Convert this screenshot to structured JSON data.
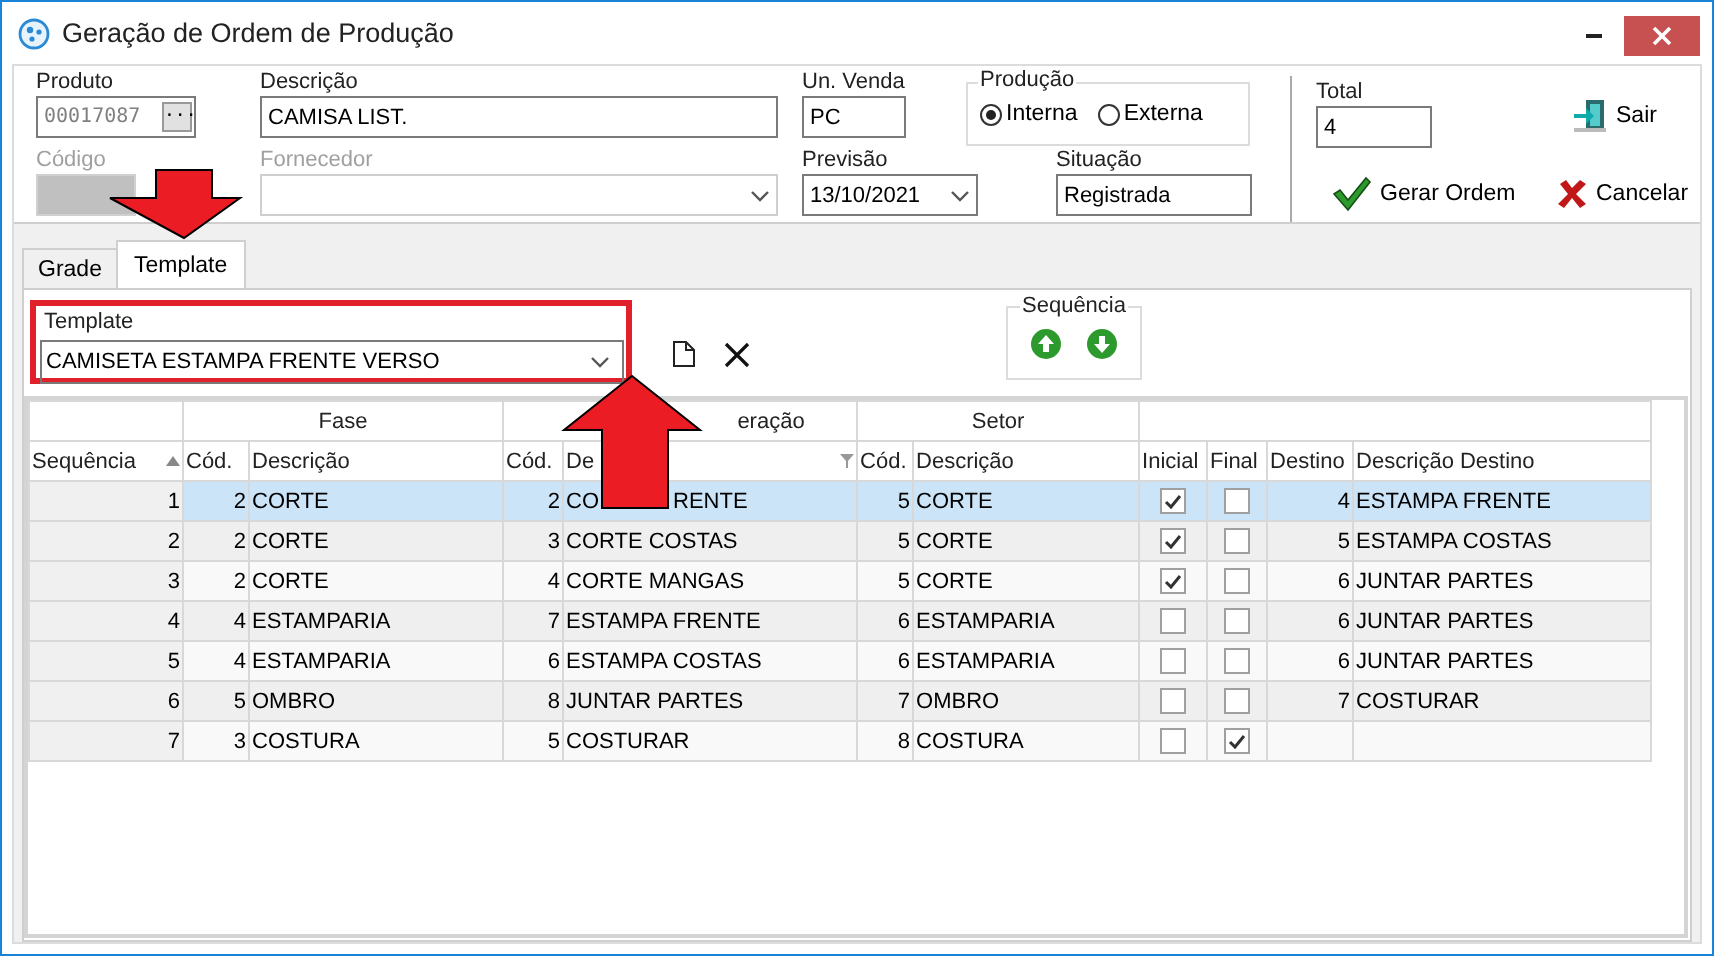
{
  "window": {
    "title": "Geração de Ordem de Produção"
  },
  "form": {
    "produto": {
      "label": "Produto",
      "value": "00017087",
      "lookup": "..."
    },
    "descricao": {
      "label": "Descrição",
      "value": "CAMISA LIST."
    },
    "un_venda": {
      "label": "Un. Venda",
      "value": "PC"
    },
    "codigo": {
      "label": "Código",
      "disabled": true
    },
    "fornecedor": {
      "label": "Fornecedor",
      "disabled": true
    },
    "previsao": {
      "label": "Previsão",
      "value": "13/10/2021"
    },
    "situacao": {
      "label": "Situação",
      "value": "Registrada"
    },
    "producao": {
      "label": "Produção",
      "options": [
        {
          "label": "Interna",
          "selected": true
        },
        {
          "label": "Externa",
          "selected": false
        }
      ]
    },
    "total": {
      "label": "Total",
      "value": "4"
    }
  },
  "buttons": [
    {
      "kind": "exit",
      "label": "Sair"
    },
    {
      "kind": "confirm",
      "label": "Gerar Ordem"
    },
    {
      "kind": "cancel",
      "label": "Cancelar"
    }
  ],
  "tabs": [
    {
      "label": "Grade",
      "selected": false
    },
    {
      "label": "Template",
      "selected": true
    }
  ],
  "template": {
    "label": "Template",
    "value": "CAMISETA ESTAMPA FRENTE VERSO"
  },
  "sequencia": {
    "label": "Sequência"
  },
  "table": {
    "bands": [
      {
        "label": "Fase"
      },
      {
        "label": "eração"
      },
      {
        "label": "Setor"
      }
    ],
    "columns": [
      "Sequência",
      "Cód.",
      "Descrição",
      "Cód.",
      "De",
      "Cód.",
      "Descrição",
      "Inicial",
      "Final",
      "Destino",
      "Descrição Destino"
    ],
    "rows": [
      {
        "seq": "1",
        "fase_cod": "2",
        "fase": "CORTE",
        "op_cod": "2",
        "op": "CO",
        "op_tail": "RENTE",
        "setor_cod": "5",
        "setor": "CORTE",
        "inicial": true,
        "final": false,
        "destino": "4",
        "destino_desc": "ESTAMPA FRENTE",
        "selected": true
      },
      {
        "seq": "2",
        "fase_cod": "2",
        "fase": "CORTE",
        "op_cod": "3",
        "op": "CORTE COSTAS",
        "setor_cod": "5",
        "setor": "CORTE",
        "inicial": true,
        "final": false,
        "destino": "5",
        "destino_desc": "ESTAMPA COSTAS",
        "selected": false
      },
      {
        "seq": "3",
        "fase_cod": "2",
        "fase": "CORTE",
        "op_cod": "4",
        "op": "CORTE MANGAS",
        "setor_cod": "5",
        "setor": "CORTE",
        "inicial": true,
        "final": false,
        "destino": "6",
        "destino_desc": "JUNTAR PARTES",
        "selected": false
      },
      {
        "seq": "4",
        "fase_cod": "4",
        "fase": "ESTAMPARIA",
        "op_cod": "7",
        "op": "ESTAMPA FRENTE",
        "setor_cod": "6",
        "setor": "ESTAMPARIA",
        "inicial": false,
        "final": false,
        "destino": "6",
        "destino_desc": "JUNTAR PARTES",
        "selected": false
      },
      {
        "seq": "5",
        "fase_cod": "4",
        "fase": "ESTAMPARIA",
        "op_cod": "6",
        "op": "ESTAMPA COSTAS",
        "setor_cod": "6",
        "setor": "ESTAMPARIA",
        "inicial": false,
        "final": false,
        "destino": "6",
        "destino_desc": "JUNTAR PARTES",
        "selected": false
      },
      {
        "seq": "6",
        "fase_cod": "5",
        "fase": "OMBRO",
        "op_cod": "8",
        "op": "JUNTAR PARTES",
        "setor_cod": "7",
        "setor": "OMBRO",
        "inicial": false,
        "final": false,
        "destino": "7",
        "destino_desc": "COSTURAR",
        "selected": false
      },
      {
        "seq": "7",
        "fase_cod": "3",
        "fase": "COSTURA",
        "op_cod": "5",
        "op": "COSTURAR",
        "setor_cod": "8",
        "setor": "COSTURA",
        "inicial": false,
        "final": true,
        "selected": false
      }
    ]
  },
  "annotations": [
    {
      "kind": "arrow-down"
    },
    {
      "kind": "arrow-up"
    }
  ]
}
